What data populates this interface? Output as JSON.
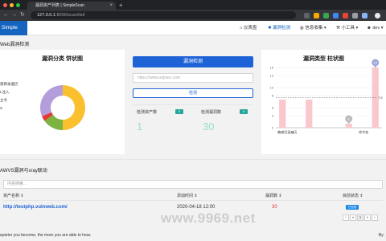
{
  "browser": {
    "tab_title": "漏洞资产列表 | SimpleScan",
    "tab_close": "×",
    "new_tab": "+",
    "url_host": "127.0.0.1",
    "url_path": ":8000/scan/list/",
    "back": "←",
    "forward": "→",
    "reload": "↻"
  },
  "navbar": {
    "brand": "Simple",
    "items": [
      {
        "label": "仪表盘",
        "icon": "home-icon"
      },
      {
        "label": "漏洞检测",
        "icon": "bug-icon",
        "active": true
      },
      {
        "label": "信息收集",
        "icon": "globe-icon",
        "dropdown": "▾"
      },
      {
        "label": "小工具",
        "icon": "tools-icon",
        "dropdown": "▾"
      },
      {
        "label": "dev",
        "icon": "user-icon",
        "dropdown": "▾"
      }
    ]
  },
  "page": {
    "title": "Web漏洞检测"
  },
  "pie_panel": {
    "title": "漏洞分类 饼状图",
    "legend": [
      "感目录遍历",
      "L注入",
      "立令",
      "S"
    ]
  },
  "detect_panel": {
    "header": "漏洞检测",
    "input_placeholder": "https://www.sojisec.com",
    "button": "检测",
    "stats": [
      {
        "label": "检测资产数",
        "tag": "5",
        "value": "1",
        "tag_color": "#26a69a"
      },
      {
        "label": "检测漏洞数",
        "tag": "5",
        "value": "30",
        "tag_color": "#26a69a"
      }
    ]
  },
  "bar_panel": {
    "title": "漏洞类型 柱状图"
  },
  "chart_data": [
    {
      "type": "pie",
      "title": "漏洞分类 饼状图",
      "slices": [
        {
          "name": "感目录遍历",
          "value": 20,
          "color": "#fbc02d"
        },
        {
          "name": "L注入",
          "value": 6,
          "color": "#7cb342"
        },
        {
          "name": "立令",
          "value": 1.5,
          "color": "#e53935"
        },
        {
          "name": "S",
          "value": 12.5,
          "color": "#b39ddb"
        }
      ]
    },
    {
      "type": "bar",
      "title": "漏洞类型 柱状图",
      "categories": [
        "敏感目录遍历",
        "",
        "",
        "",
        "",
        "",
        "命令执",
        ""
      ],
      "values": [
        7,
        0,
        7,
        0,
        0,
        1,
        0,
        15
      ],
      "ylim": [
        0,
        15
      ],
      "yticks": [
        0,
        3,
        5,
        8,
        10,
        13,
        15
      ],
      "average_line": 7.5,
      "average_label": "7.5",
      "bar_color": "#f8c8cc",
      "markers": [
        {
          "category_index": 7,
          "value": 15,
          "label": "15",
          "color": "#9fa8da"
        },
        {
          "category_index": 5,
          "value": 1,
          "label": "1",
          "color": "#bdbdbd"
        }
      ]
    }
  ],
  "table_section": {
    "title": "AWVS漏洞与xray联动",
    "search_placeholder": "内容搜索...",
    "columns": [
      "资产名称 ⇕",
      "添加时间 ⇕",
      "漏洞数 ⇕",
      "目前状态 ⇕"
    ],
    "rows": [
      {
        "asset": "http://testphp.vulnweb.com/",
        "time": "2020-04-18 12:00",
        "vulns": "30",
        "status": "已完成"
      }
    ],
    "pager": [
      "‹",
      "«",
      "1",
      "»",
      "›"
    ]
  },
  "footer": {
    "left": "quieter you become, the more you are able to hear.",
    "right": "By:"
  },
  "watermark": "www.9969.net"
}
